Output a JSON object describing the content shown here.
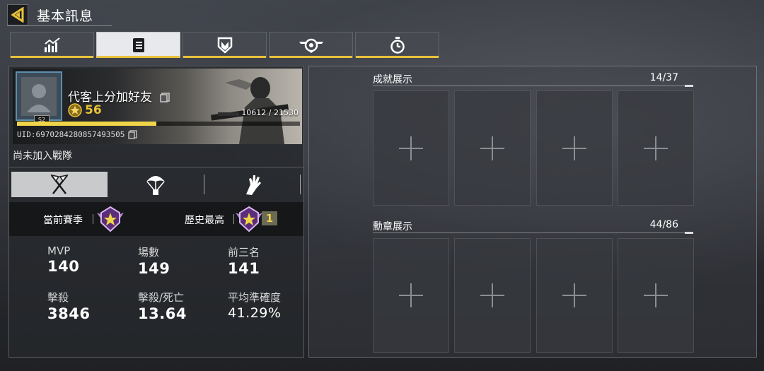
{
  "header": {
    "title": "基本訊息",
    "back_icon": "back-arrow-icon",
    "accent": "#e8c23a"
  },
  "tabs": [
    {
      "icon": "stats-chart-icon",
      "active": false
    },
    {
      "icon": "document-icon",
      "active": true
    },
    {
      "icon": "shield-emblem-icon",
      "active": false
    },
    {
      "icon": "winged-badge-icon",
      "active": false
    },
    {
      "icon": "stopwatch-icon",
      "active": false
    }
  ],
  "profile": {
    "name": "代客上分加好友",
    "level": "56",
    "xp_text": "10612 / 21530",
    "xp_fraction": 0.493,
    "uid": "UID:6970284280857493505",
    "rank_badge": "S2",
    "clan_status": "尚未加入戰隊"
  },
  "modes": [
    {
      "icon": "multiplayer-flags-icon",
      "active": true
    },
    {
      "icon": "parachute-icon",
      "active": false
    },
    {
      "icon": "zombie-hand-icon",
      "active": false
    }
  ],
  "ranks": {
    "current_label": "當前賽季",
    "best_label": "歷史最高",
    "best_count": "1"
  },
  "stats": [
    {
      "label": "MVP",
      "value": "140"
    },
    {
      "label": "場數",
      "value": "149"
    },
    {
      "label": "前三名",
      "value": "141"
    },
    {
      "label": "擊殺",
      "value": "3846"
    },
    {
      "label": "擊殺/死亡",
      "value": "13.64"
    },
    {
      "label": "平均準確度",
      "value": "41.29%"
    }
  ],
  "achievements": {
    "title": "成就展示",
    "count": "14/37"
  },
  "medals": {
    "title": "勳章展示",
    "count": "44/86"
  }
}
